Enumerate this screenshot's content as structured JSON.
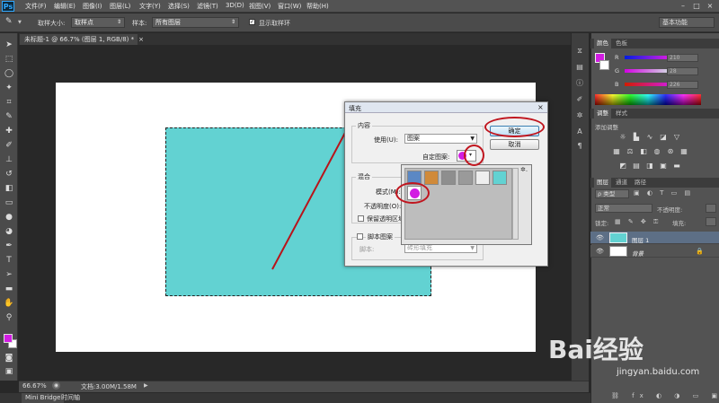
{
  "menubar": {
    "items": [
      "文件(F)",
      "编辑(E)",
      "图像(I)",
      "图层(L)",
      "文字(Y)",
      "选择(S)",
      "滤镜(T)",
      "3D(D)",
      "视图(V)",
      "窗口(W)",
      "帮助(H)"
    ]
  },
  "options": {
    "sample_size_label": "取样大小:",
    "sample_size_value": "取样点",
    "sample_label": "样本:",
    "sample_value": "所有图层",
    "show_ring_label": "显示取样环",
    "workspace": "基本功能"
  },
  "document": {
    "tab_title": "未标题-1 @ 66.7% (图层 1, RGB/8) *",
    "zoom": "66.67%",
    "doc_size": "文档:3.00M/1.58M"
  },
  "bottom_tabs": [
    "Mini Bridge",
    "时间轴"
  ],
  "color_panel": {
    "tabs": [
      "颜色",
      "色板"
    ],
    "channels": [
      {
        "label": "R",
        "value": "210"
      },
      {
        "label": "G",
        "value": "28"
      },
      {
        "label": "B",
        "value": "226"
      }
    ],
    "fg_color": "#d21ce2"
  },
  "adjust_panel": {
    "tabs": [
      "调整",
      "样式"
    ],
    "hint": "添加调整"
  },
  "layers_panel": {
    "tabs": [
      "图层",
      "通道",
      "路径"
    ],
    "filter_label": "ρ 类型",
    "blend_mode": "正常",
    "opacity_label": "不透明度:",
    "lock_label": "锁定:",
    "fill_label": "填充:",
    "layers": [
      {
        "name": "图层 1"
      },
      {
        "name": "背景"
      }
    ]
  },
  "fill_dialog": {
    "title": "填充",
    "content_group": "内容",
    "use_label": "使用(U):",
    "use_value": "图案",
    "custom_pattern_label": "自定图案:",
    "blend_group": "混合",
    "mode_label": "模式(M):",
    "opacity_label": "不透明度(O):",
    "preserve_label": "保留透明区域",
    "script_label": "脚本图案",
    "script_sub_label": "脚本:",
    "script_value": "砖形填充",
    "ok": "确定",
    "cancel": "取消",
    "gear": "✲."
  },
  "pattern_swatches": [
    {
      "color": "#5b88c4"
    },
    {
      "color": "#d08a3a"
    },
    {
      "color": "#8e8e8e"
    },
    {
      "color": "#9a9a9a"
    },
    {
      "color": "#eeeeee"
    },
    {
      "color": "#62d2d2"
    }
  ],
  "watermark": {
    "brand": "Bai经验",
    "url": "jingyan.baidu.com"
  }
}
